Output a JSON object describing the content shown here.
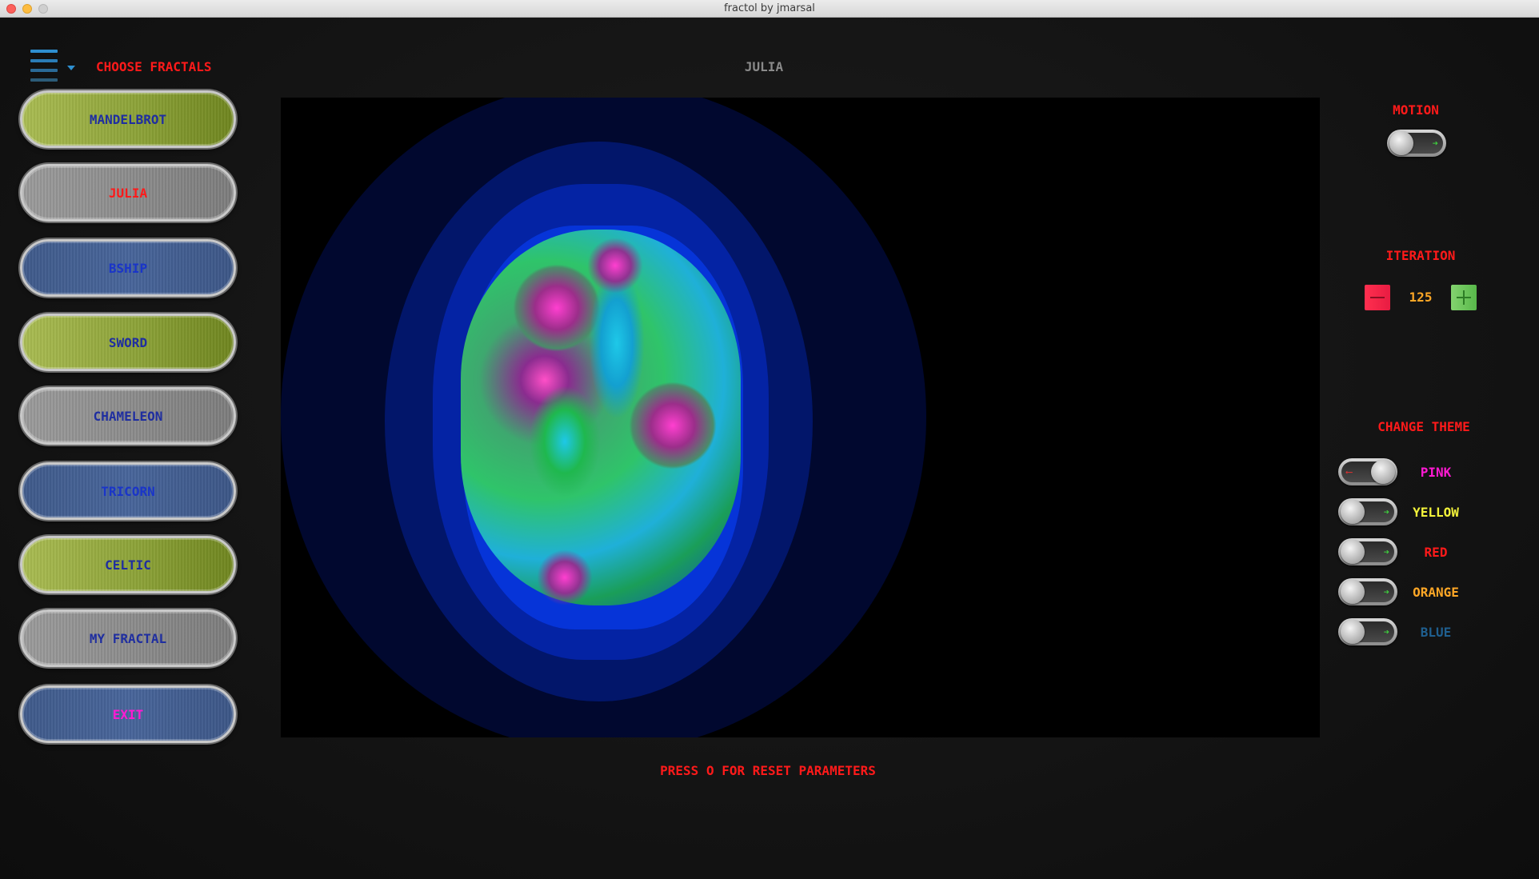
{
  "window": {
    "title": "fractol by jmarsal"
  },
  "menu": {
    "choose_label": "CHOOSE FRACTALS"
  },
  "current_fractal": "JULIA",
  "fractal_buttons": [
    {
      "label": "MANDELBROT",
      "style": "green",
      "text_color": "#1f2ea0"
    },
    {
      "label": "JULIA",
      "style": "silver",
      "text_color": "#ff1a1a"
    },
    {
      "label": "BSHIP",
      "style": "blue",
      "text_color": "#1a35c8"
    },
    {
      "label": "SWORD",
      "style": "green",
      "text_color": "#1f2ea0"
    },
    {
      "label": "CHAMELEON",
      "style": "silver",
      "text_color": "#1f2ea0"
    },
    {
      "label": "TRICORN",
      "style": "blue",
      "text_color": "#1a35c8"
    },
    {
      "label": "CELTIC",
      "style": "green",
      "text_color": "#1f2ea0"
    },
    {
      "label": "MY FRACTAL",
      "style": "silver",
      "text_color": "#1f2ea0"
    },
    {
      "label": "EXIT",
      "style": "blue",
      "text_color": "#ff1ad2"
    }
  ],
  "motion": {
    "label": "MOTION",
    "state": "off"
  },
  "iteration": {
    "label": "ITERATION",
    "value": "125"
  },
  "theme": {
    "label": "CHANGE THEME",
    "options": [
      {
        "label": "PINK",
        "color": "#ff1ad2",
        "state": "on"
      },
      {
        "label": "YELLOW",
        "color": "#f2f23a",
        "state": "off"
      },
      {
        "label": "RED",
        "color": "#ff1a1a",
        "state": "off"
      },
      {
        "label": "ORANGE",
        "color": "#ffa726",
        "state": "off"
      },
      {
        "label": "BLUE",
        "color": "#1f5f8f",
        "state": "off"
      }
    ]
  },
  "footer": {
    "reset_message": "PRESS O FOR RESET PARAMETERS"
  }
}
